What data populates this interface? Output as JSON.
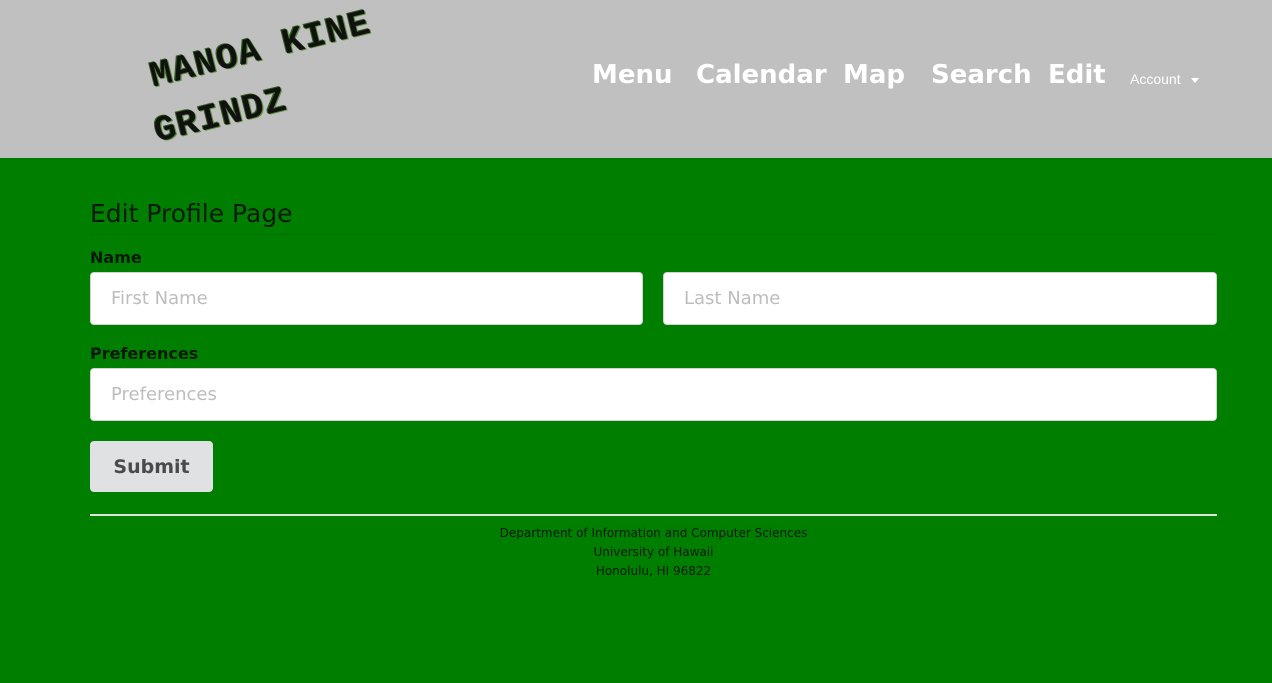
{
  "header": {
    "logo_line1": "MANOA KINE",
    "logo_line2": "GRINDZ",
    "nav": [
      "Menu",
      "Calendar",
      "Map",
      "Search",
      "Edit"
    ],
    "account_label": "Account"
  },
  "form": {
    "title": "Edit Profile Page",
    "name_label": "Name",
    "first_name_placeholder": "First Name",
    "last_name_placeholder": "Last Name",
    "preferences_label": "Preferences",
    "preferences_placeholder": "Preferences",
    "submit_label": "Submit"
  },
  "footer": {
    "line1": "Department of Information and Computer Sciences",
    "line2": "University of Hawaii",
    "line3": "Honolulu, HI 96822"
  },
  "colors": {
    "background": "#007e00",
    "header": "#c0c0c0"
  }
}
